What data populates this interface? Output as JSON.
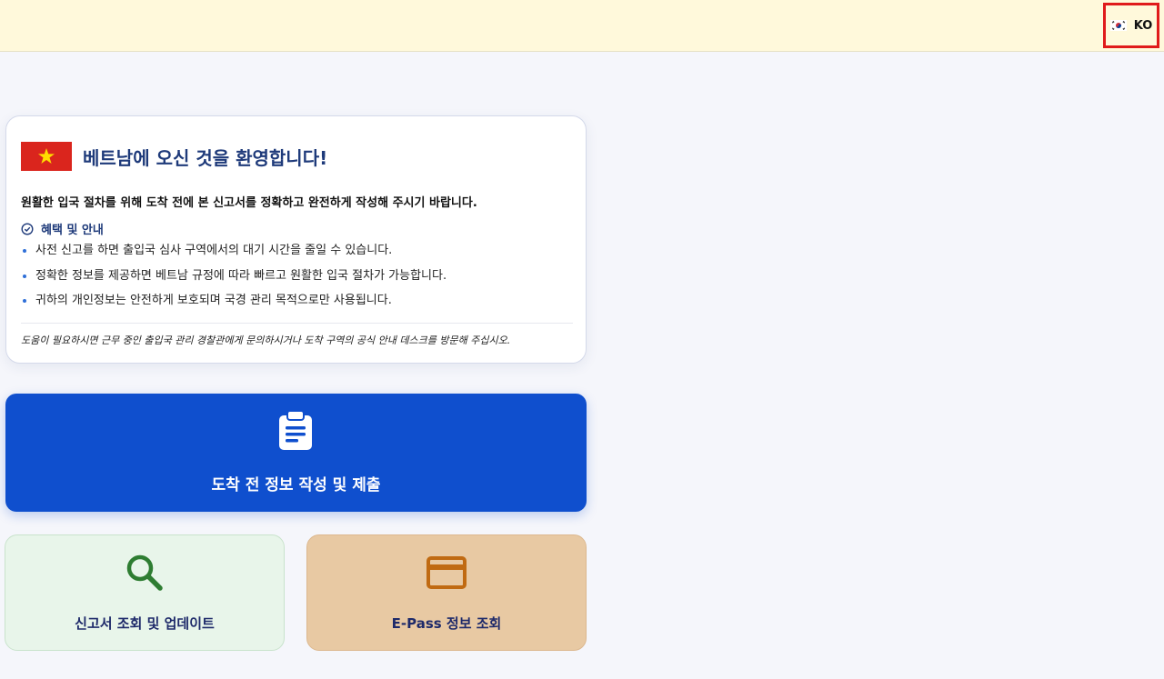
{
  "header": {
    "language_code": "KO",
    "flag_icon": "south-korea-flag-icon"
  },
  "welcome": {
    "flag_icon": "vietnam-flag-icon",
    "title": "베트남에 오신 것을 환영합니다!",
    "intro": "원활한 입국 절차를 위해 도착 전에 본 신고서를 정확하고 완전하게 작성해 주시기 바랍니다.",
    "benefits_title": "혜택 및 안내",
    "benefits": [
      "사전 신고를 하면 출입국 심사 구역에서의 대기 시간을 줄일 수 있습니다.",
      "정확한 정보를 제공하면 베트남 규정에 따라 빠르고 원활한 입국 절차가 가능합니다.",
      "귀하의 개인정보는 안전하게 보호되며 국경 관리 목적으로만 사용됩니다."
    ],
    "help_note": "도움이 필요하시면 근무 중인 출입국 관리 경찰관에게 문의하시거나 도착 구역의 공식 안내 데스크를 방문해 주십시오."
  },
  "actions": {
    "primary": {
      "label": "도착 전 정보 작성 및 제출",
      "icon": "clipboard-icon"
    },
    "lookup": {
      "label": "신고서 조회 및 업데이트",
      "icon": "search-icon"
    },
    "epass": {
      "label": "E-Pass 정보 조회",
      "icon": "credit-card-icon"
    }
  },
  "colors": {
    "topbar_bg": "#fff9db",
    "primary_blue": "#0f4fce",
    "title_navy": "#1e3a7a",
    "lookup_bg": "#e8f5ea",
    "epass_bg": "#e8c9a3",
    "highlight_red": "#e01b1b"
  }
}
